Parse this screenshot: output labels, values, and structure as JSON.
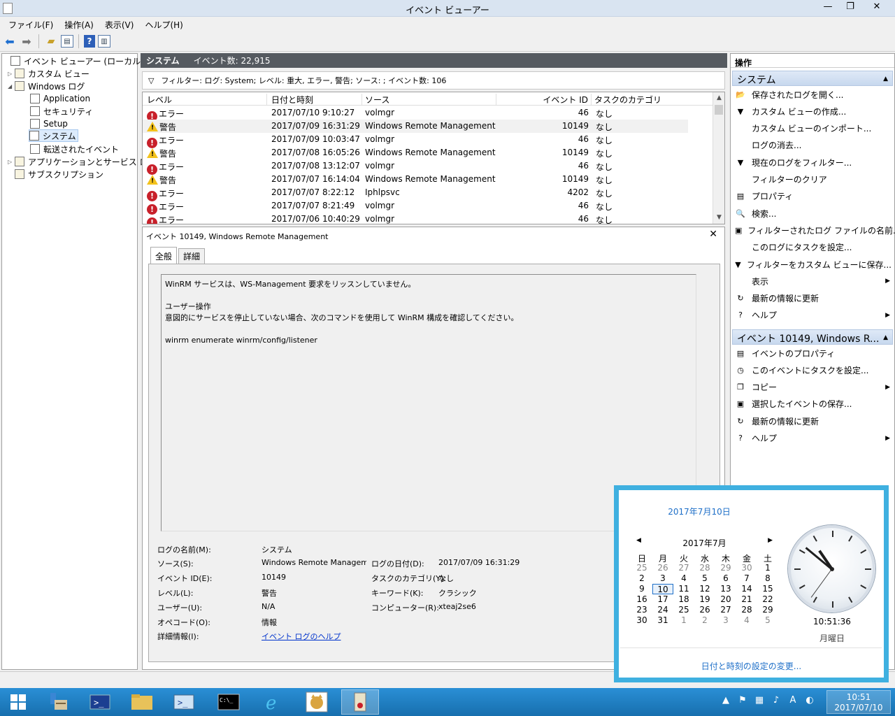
{
  "window": {
    "title": "イベント ビューアー",
    "minimize": "—",
    "maximize": "❐",
    "close": "✕"
  },
  "menu": [
    "ファイル(F)",
    "操作(A)",
    "表示(V)",
    "ヘルプ(H)"
  ],
  "toolbar": {
    "icons": [
      "back-icon",
      "forward-icon",
      "folder-up-icon",
      "console-tree-icon",
      "help-icon",
      "action-pane-icon"
    ]
  },
  "tree": [
    {
      "label": "イベント ビューアー (ローカル)",
      "exp": ""
    },
    {
      "label": "カスタム ビュー",
      "exp": "▷"
    },
    {
      "label": "Windows ログ",
      "exp": "◢"
    },
    {
      "label": "Application",
      "exp": ""
    },
    {
      "label": "セキュリティ",
      "exp": ""
    },
    {
      "label": "Setup",
      "exp": ""
    },
    {
      "label": "システム",
      "exp": ""
    },
    {
      "label": "転送されたイベント",
      "exp": ""
    },
    {
      "label": "アプリケーションとサービス ログ",
      "exp": "▷"
    },
    {
      "label": "サブスクリプション",
      "exp": ""
    }
  ],
  "center": {
    "header_name": "システム",
    "header_count": "イベント数: 22,915",
    "filter": "フィルター: ログ: System; レベル: 重大, エラー, 警告; ソース: ; イベント数: 106",
    "columns": [
      "レベル",
      "日付と時刻",
      "ソース",
      "イベント ID",
      "タスクのカテゴリ"
    ],
    "rows": [
      {
        "type": "error",
        "level": "エラー",
        "date": "2017/07/10 9:10:27",
        "source": "volmgr",
        "id": "46",
        "task": "なし"
      },
      {
        "type": "warn",
        "level": "警告",
        "date": "2017/07/09 16:31:29",
        "source": "Windows Remote Management",
        "id": "10149",
        "task": "なし"
      },
      {
        "type": "error",
        "level": "エラー",
        "date": "2017/07/09 10:03:47",
        "source": "volmgr",
        "id": "46",
        "task": "なし"
      },
      {
        "type": "warn",
        "level": "警告",
        "date": "2017/07/08 16:05:26",
        "source": "Windows Remote Management",
        "id": "10149",
        "task": "なし"
      },
      {
        "type": "error",
        "level": "エラー",
        "date": "2017/07/08 13:12:07",
        "source": "volmgr",
        "id": "46",
        "task": "なし"
      },
      {
        "type": "warn",
        "level": "警告",
        "date": "2017/07/07 16:14:04",
        "source": "Windows Remote Management",
        "id": "10149",
        "task": "なし"
      },
      {
        "type": "error",
        "level": "エラー",
        "date": "2017/07/07 8:22:12",
        "source": "Iphlpsvc",
        "id": "4202",
        "task": "なし"
      },
      {
        "type": "error",
        "level": "エラー",
        "date": "2017/07/07 8:21:49",
        "source": "volmgr",
        "id": "46",
        "task": "なし"
      },
      {
        "type": "error",
        "level": "エラー",
        "date": "2017/07/06 10:40:29",
        "source": "volmgr",
        "id": "46",
        "task": "なし"
      }
    ]
  },
  "detail": {
    "title": "イベント 10149, Windows Remote Management",
    "close": "✕",
    "tabs": [
      "全般",
      "詳細"
    ],
    "message": [
      "WinRM サービスは、WS-Management 要求をリッスンしていません。",
      "",
      "ユーザー操作",
      "意図的にサービスを停止していない場合、次のコマンドを使用して WinRM 構成を確認してください。",
      "",
      "winrm enumerate winrm/config/listener"
    ],
    "props": {
      "log_name_label": "ログの名前(M):",
      "log_name": "システム",
      "source_label": "ソース(S):",
      "source": "Windows Remote Managemer",
      "logged_label": "ログの日付(D):",
      "logged": "2017/07/09 16:31:29",
      "event_id_label": "イベント ID(E):",
      "event_id": "10149",
      "task_label": "タスクのカテゴリ(Y):",
      "task": "なし",
      "level_label": "レベル(L):",
      "level": "警告",
      "keywords_label": "キーワード(K):",
      "keywords": "クラシック",
      "user_label": "ユーザー(U):",
      "user": "N/A",
      "computer_label": "コンピューター(R):",
      "computer": "xteaj2se6",
      "opcode_label": "オペコード(O):",
      "opcode": "情報",
      "more_label": "詳細情報(I):",
      "more_link": "イベント ログのヘルプ"
    }
  },
  "actions": {
    "header": "操作",
    "section1": "システム",
    "items1": [
      {
        "label": "保存されたログを開く...",
        "icon": "open-log-icon",
        "glyph": "📂",
        "sub": ""
      },
      {
        "label": "カスタム ビューの作成...",
        "icon": "filter-create-icon",
        "glyph": "▼",
        "sub": ""
      },
      {
        "label": "カスタム ビューのインポート...",
        "icon": "",
        "glyph": "",
        "sub": ""
      },
      {
        "label": "ログの消去...",
        "icon": "",
        "glyph": "",
        "sub": ""
      },
      {
        "label": "現在のログをフィルター...",
        "icon": "filter-icon",
        "glyph": "▼",
        "sub": ""
      },
      {
        "label": "フィルターのクリア",
        "icon": "",
        "glyph": "",
        "sub": ""
      },
      {
        "label": "プロパティ",
        "icon": "properties-icon",
        "glyph": "▤",
        "sub": ""
      },
      {
        "label": "検索...",
        "icon": "find-icon",
        "glyph": "🔍",
        "sub": ""
      },
      {
        "label": "フィルターされたログ ファイルの名前...",
        "icon": "save-icon",
        "glyph": "▣",
        "sub": ""
      },
      {
        "label": "このログにタスクを設定...",
        "icon": "",
        "glyph": "",
        "sub": ""
      },
      {
        "label": "フィルターをカスタム ビューに保存...",
        "icon": "filter-save-icon",
        "glyph": "▼",
        "sub": ""
      },
      {
        "label": "表示",
        "icon": "",
        "glyph": "",
        "sub": "▶"
      },
      {
        "label": "最新の情報に更新",
        "icon": "refresh-icon",
        "glyph": "↻",
        "sub": ""
      },
      {
        "label": "ヘルプ",
        "icon": "help-icon",
        "glyph": "?",
        "sub": "▶"
      }
    ],
    "section2": "イベント 10149, Windows R...",
    "items2": [
      {
        "label": "イベントのプロパティ",
        "icon": "event-properties-icon",
        "glyph": "▤",
        "sub": ""
      },
      {
        "label": "このイベントにタスクを設定...",
        "icon": "task-icon",
        "glyph": "◷",
        "sub": ""
      },
      {
        "label": "コピー",
        "icon": "copy-icon",
        "glyph": "❐",
        "sub": "▶"
      },
      {
        "label": "選択したイベントの保存...",
        "icon": "save-icon",
        "glyph": "▣",
        "sub": ""
      },
      {
        "label": "最新の情報に更新",
        "icon": "refresh-icon",
        "glyph": "↻",
        "sub": ""
      },
      {
        "label": "ヘルプ",
        "icon": "help-icon",
        "glyph": "?",
        "sub": "▶"
      }
    ]
  },
  "clock_popup": {
    "date_long": "2017年7月10日",
    "month": "2017年7月",
    "prev": "◀",
    "next": "▶",
    "weekdays": [
      "日",
      "月",
      "火",
      "水",
      "木",
      "金",
      "土"
    ],
    "days": [
      [
        "25",
        "26",
        "27",
        "28",
        "29",
        "30",
        "1"
      ],
      [
        "2",
        "3",
        "4",
        "5",
        "6",
        "7",
        "8"
      ],
      [
        "9",
        "10",
        "11",
        "12",
        "13",
        "14",
        "15"
      ],
      [
        "16",
        "17",
        "18",
        "19",
        "20",
        "21",
        "22"
      ],
      [
        "23",
        "24",
        "25",
        "26",
        "27",
        "28",
        "29"
      ],
      [
        "30",
        "31",
        "1",
        "2",
        "3",
        "4",
        "5"
      ]
    ],
    "today": "10",
    "time": "10:51:36",
    "weekday_name": "月曜日",
    "change_link": "日付と時刻の設定の変更..."
  },
  "taskbar": {
    "apps": [
      "server-manager-icon",
      "powershell-icon",
      "file-explorer-icon",
      "powershell-ise-icon",
      "command-prompt-icon",
      "internet-explorer-icon",
      "tomcat-icon",
      "event-viewer-icon"
    ],
    "tray": [
      "▲",
      "⚑",
      "▦",
      "♪",
      "A",
      "◐"
    ],
    "time": "10:51",
    "date": "2017/07/10"
  }
}
